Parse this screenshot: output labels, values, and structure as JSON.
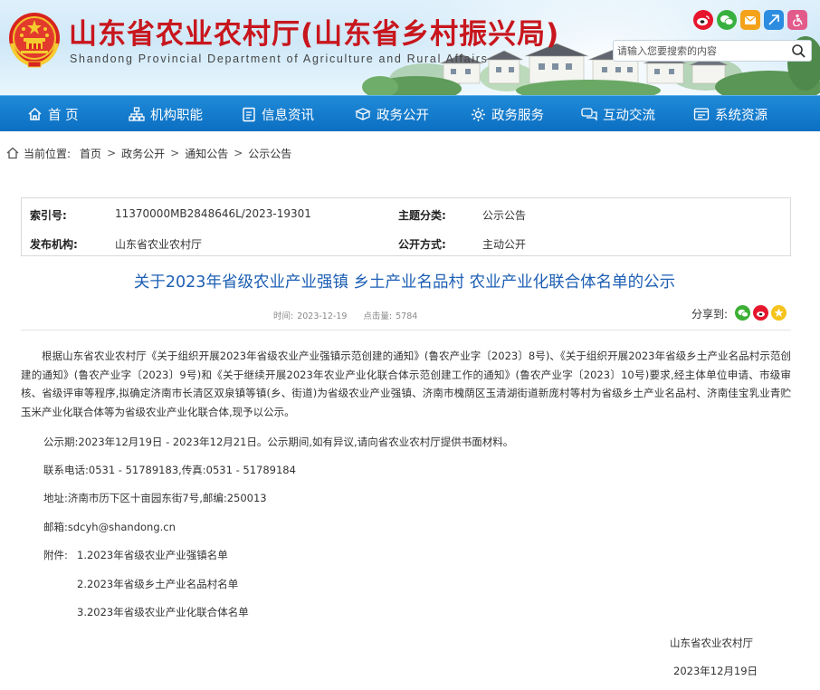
{
  "header": {
    "title": "山东省农业农村厅(山东省乡村振兴局)",
    "subtitle": "Shandong Provincial Department of Agriculture and Rural Affairs",
    "search_placeholder": "请输入您要搜索的内容",
    "social_icons": [
      "weibo-icon",
      "wechat-icon",
      "mail-icon",
      "elder-mode-icon",
      "accessibility-icon"
    ],
    "colors": {
      "title": "#c8161d",
      "nav": "#0c6fc2"
    }
  },
  "nav": {
    "items": [
      {
        "label": "首 页",
        "icon": "home-icon"
      },
      {
        "label": "机构职能",
        "icon": "org-icon"
      },
      {
        "label": "信息资讯",
        "icon": "document-icon"
      },
      {
        "label": "政务公开",
        "icon": "box-icon"
      },
      {
        "label": "政务服务",
        "icon": "gear-icon"
      },
      {
        "label": "互动交流",
        "icon": "chat-icon"
      },
      {
        "label": "系统资源",
        "icon": "system-icon"
      }
    ]
  },
  "breadcrumb": {
    "prefix": "当前位置:",
    "items": [
      "首页",
      "政务公开",
      "通知公告",
      "公示公告"
    ],
    "separator": ">"
  },
  "meta": {
    "index_label": "索引号:",
    "index_value": "11370000MB2848646L/2023-19301",
    "topic_label": "主题分类:",
    "topic_value": "公示公告",
    "publisher_label": "发布机构:",
    "publisher_value": "山东省农业农村厅",
    "method_label": "公开方式:",
    "method_value": "主动公开"
  },
  "article": {
    "title": "关于2023年省级农业产业强镇 乡土产业名品村 农业产业化联合体名单的公示",
    "time_label": "时间:",
    "time_value": "2023-12-19",
    "clicks_label": "点击量:",
    "clicks_value": "5784",
    "share_label": "分享到:",
    "share_icons": [
      "wechat-icon",
      "weibo-icon",
      "favorite-icon"
    ],
    "paragraph1": "根据山东省农业农村厅《关于组织开展2023年省级农业产业强镇示范创建的通知》(鲁农产业字〔2023〕8号)、《关于组织开展2023年省级乡土产业名品村示范创建的通知》(鲁农产业字〔2023〕9号)和《关于继续开展2023年农业产业化联合体示范创建工作的通知》(鲁农产业字〔2023〕10号)要求,经主体单位申请、市级审核、省级评审等程序,拟确定济南市长清区双泉镇等镇(乡、街道)为省级农业产业强镇、济南市槐荫区玉清湖街道新庞村等村为省级乡土产业名品村、济南佳宝乳业青贮玉米产业化联合体等为省级农业产业化联合体,现予以公示。",
    "period": "公示期:2023年12月19日 - 2023年12月21日。公示期间,如有异议,请向省农业农村厅提供书面材料。",
    "phone": "联系电话:0531 - 51789183,传真:0531 - 51789184",
    "address": "地址:济南市历下区十亩园东街7号,邮编:250013",
    "email": "邮箱:sdcyh@shandong.cn",
    "attachments_label": "附件:",
    "attachments": [
      "1.2023年省级农业产业强镇名单",
      "2.2023年省级乡土产业名品村名单",
      "3.2023年省级农业产业化联合体名单"
    ],
    "signature": "山东省农业农村厅",
    "date": "2023年12月19日"
  }
}
